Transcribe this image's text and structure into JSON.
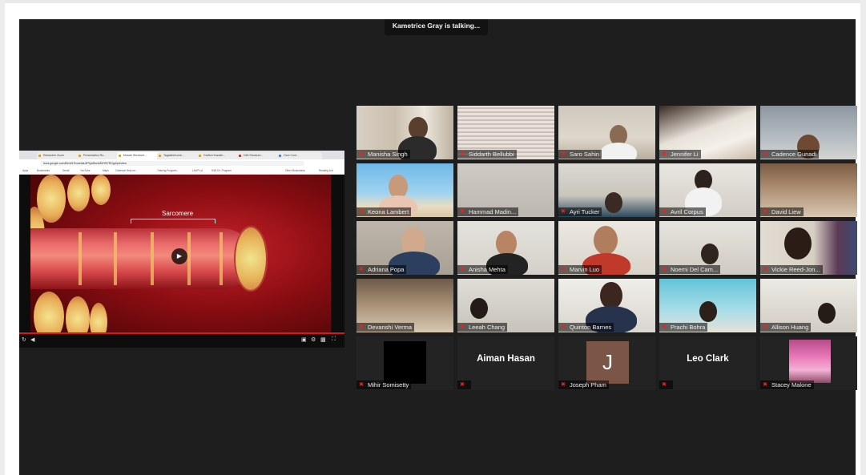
{
  "meeting": {
    "speaker_banner": "Kametrice Gray is talking..."
  },
  "shared_screen": {
    "browser_tabs": [
      "Reteacher Zoom",
      "Presentation Ro...",
      "Muscle Structure...",
      "Tagalabelcontr...",
      "Grafton Kazakh...",
      "D48 Structure...",
      "Ocre Cont..."
    ],
    "url": "docs.google.com/file/d/1ExuxntaL8F9yeBorsMMYB7RGgd/preview",
    "bookmarks": [
      "Apps",
      "Bookmarks",
      "Gmail",
      "YouTube",
      "Maps",
      "Calendar Help ne...",
      "Training Program...",
      "LAUP LA",
      "D48 Ch. Program",
      "Other Bookmarks",
      "Reading List"
    ],
    "video_label": "Sarcomere",
    "controls": {
      "play_icon": "play-icon",
      "replay_icon": "replay-icon",
      "volume_icon": "volume-icon",
      "captions_icon": "captions-icon",
      "settings_icon": "gear-icon",
      "pip_icon": "picture-in-picture-icon",
      "fullscreen_icon": "fullscreen-icon"
    }
  },
  "participants": [
    {
      "name": "Manisha Singh",
      "muted": true
    },
    {
      "name": "Siddarth Bellubbi",
      "muted": true
    },
    {
      "name": "Saro Sahin",
      "muted": true
    },
    {
      "name": "Jennifer Li",
      "muted": true
    },
    {
      "name": "Cadence Gunadi",
      "muted": true
    },
    {
      "name": "Keona Lambert",
      "muted": true
    },
    {
      "name": "Hammad Madin...",
      "muted": true
    },
    {
      "name": "Ayri Tucker",
      "muted": true
    },
    {
      "name": "Avril Corpus",
      "muted": true
    },
    {
      "name": "David Liew",
      "muted": true
    },
    {
      "name": "Adriana Popa",
      "muted": true
    },
    {
      "name": "Anisha Mehta",
      "muted": true
    },
    {
      "name": "Marvin Luo",
      "muted": true
    },
    {
      "name": "Noemi Del Cam...",
      "muted": true
    },
    {
      "name": "Vickie Reed-Jon...",
      "muted": true
    },
    {
      "name": "Devanshi Verma",
      "muted": true
    },
    {
      "name": "Leeah Chang",
      "muted": true
    },
    {
      "name": "Quinton Barnes",
      "muted": true
    },
    {
      "name": "Prachi Bohra",
      "muted": true
    },
    {
      "name": "Allison Huang",
      "muted": true
    },
    {
      "name": "Mihir Somisetty",
      "muted": true
    },
    {
      "name": "",
      "muted": true,
      "display_name": "Aiman Hasan"
    },
    {
      "name": "Joseph Pham",
      "muted": true,
      "avatar_letter": "J"
    },
    {
      "name": "",
      "muted": true,
      "display_name": "Leo Clark"
    },
    {
      "name": "Stacey Malone",
      "muted": true
    }
  ],
  "colors": {
    "meeting_bg": "#1e1e1e",
    "mute_red": "#e02727",
    "progress_red": "#d31b1b"
  }
}
